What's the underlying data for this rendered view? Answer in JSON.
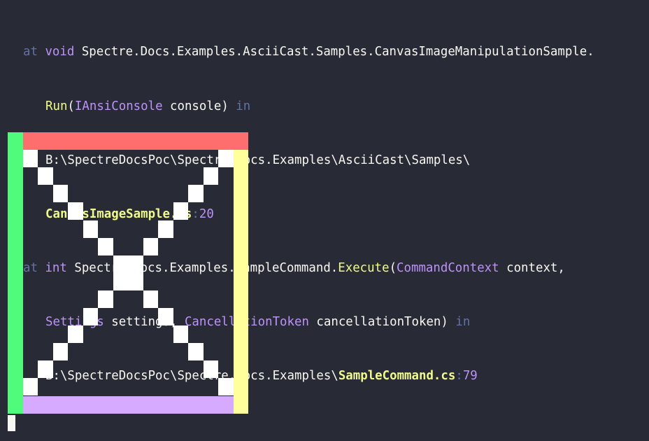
{
  "terminal": {
    "frames": [
      {
        "at": "at",
        "return_type": "void",
        "class_path": "Spectre.Docs.Examples.AsciiCast.Samples.CanvasImageManipulationSample.",
        "method": "Run",
        "open_paren": "(",
        "param1_type": "IAnsiConsole",
        "param1_name": " console",
        "close_paren": ")",
        "in": "in",
        "path": "B:\\SpectreDocsPoc\\Spectre.Docs.Examples\\AsciiCast\\Samples\\",
        "file": "CanvasImageSample.cs",
        "colon": ":",
        "line": "20"
      },
      {
        "at": "at",
        "return_type": "int",
        "class_path": "Spectre.Docs.Examples.SampleCommand.",
        "method": "Execute",
        "open_paren": "(",
        "param1_type": "CommandContext",
        "param1_name": " context,",
        "param2_type": "Settings",
        "param2_name": " settings, ",
        "param3_type": "CancellationToken",
        "param3_name": " cancellationToken)",
        "in": "in",
        "path": "B:\\SpectreDocsPoc\\Spectre.Docs.Examples\\",
        "file": "SampleCommand.cs",
        "colon": ":",
        "line": "79"
      }
    ]
  },
  "canvas_image": {
    "description_colors": {
      "background": "#282a36",
      "top_border": "#ff6e6e",
      "left_border": "#50fa7b",
      "right_border": "#ffff9c",
      "bottom_border": "#d6aaff",
      "diagonal": "#ffffff"
    },
    "grid": {
      "cols": 16,
      "rows": 16
    }
  }
}
